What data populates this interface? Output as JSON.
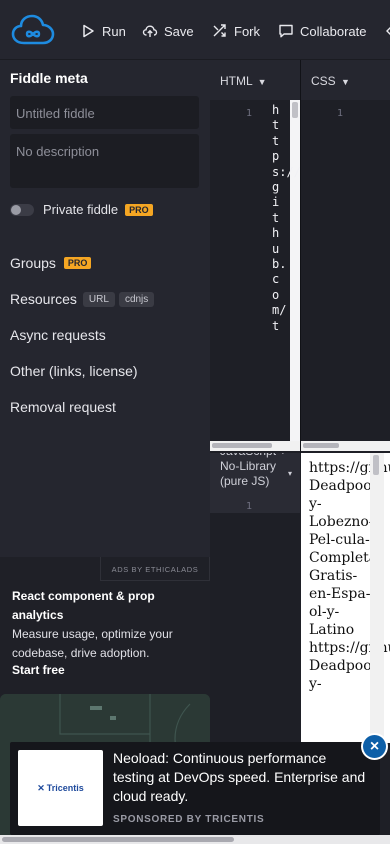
{
  "toolbar": {
    "run_label": "Run",
    "save_label": "Save",
    "fork_label": "Fork",
    "collaborate_label": "Collaborate",
    "brand_color": "#1e8be0"
  },
  "sidebar": {
    "title": "Fiddle meta",
    "name_placeholder": "Untitled fiddle",
    "description_placeholder": "No description",
    "private_label": "Private fiddle",
    "pro_badge": "PRO",
    "groups_label": "Groups",
    "resources_label": "Resources",
    "resources_chips": [
      "URL",
      "cdnjs"
    ],
    "async_label": "Async requests",
    "other_label": "Other (links, license)",
    "removal_label": "Removal request"
  },
  "ad": {
    "ads_by": "ADS BY ETHICALADS",
    "title": "React component & prop analytics",
    "description": "Measure usage, optimize your codebase, drive adoption.",
    "cta": "Start free"
  },
  "editors": {
    "html_tab": "HTML",
    "css_tab": "CSS",
    "line_one": "1",
    "html_content": "https://github.com/t",
    "js_panel_text": "JavaScript + No-Library (pure JS)"
  },
  "result": {
    "text": "https://github.com/VER-Deadpool-y-Lobezno-Pel-cula-Completa-Gratis-en-Espa-ol-y-Latino\nhttps://github.com/VER-Deadpool-y-"
  },
  "banner": {
    "logo_text": "Tricentis",
    "text": "Neoload: Continuous performance testing at DevOps speed. Enterprise and cloud ready.",
    "sponsor": "SPONSORED BY TRICENTIS"
  }
}
